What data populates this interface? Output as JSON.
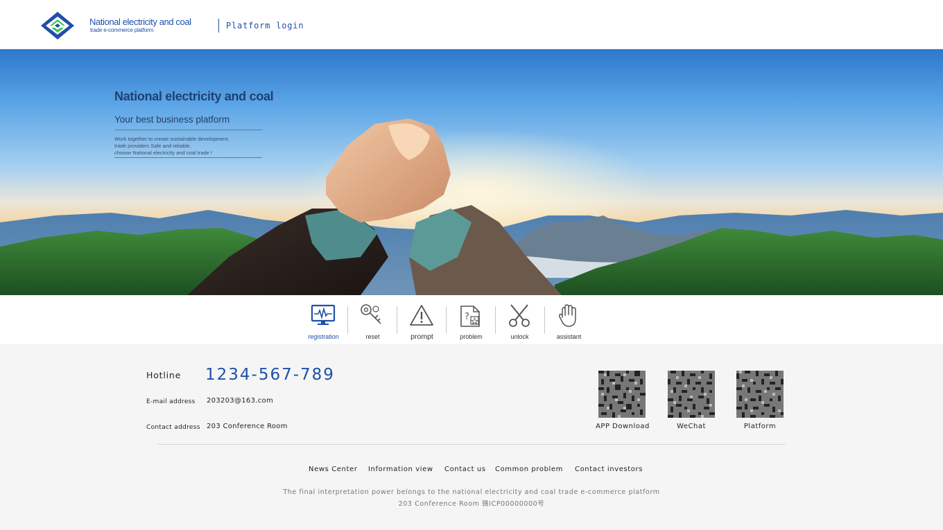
{
  "header": {
    "logo_title": "National electricity and coal",
    "logo_subtitle": "trade e-commerce platform",
    "platform_login": "Platform login"
  },
  "banner": {
    "title": "National electricity and coal",
    "subtitle": "Your best business platform",
    "description": [
      "Work together to create sustainable development,",
      "trade providers Safe and reliable,",
      "choose National electricity and coal trade !"
    ]
  },
  "quickbar": {
    "items": [
      {
        "label": "registration",
        "icon": "monitor-pulse-icon",
        "active": true
      },
      {
        "label": "reset",
        "icon": "key-icon",
        "active": false
      },
      {
        "label": "prompt",
        "icon": "warning-icon",
        "active": false
      },
      {
        "label": "problem",
        "icon": "question-document-icon",
        "active": false
      },
      {
        "label": "unlock",
        "icon": "scissors-icon",
        "active": false
      },
      {
        "label": "assistant",
        "icon": "hand-icon",
        "active": false
      }
    ]
  },
  "contact": {
    "hotline_label": "Hotline",
    "hotline": "1234-567-789",
    "email_label": "E-mail address",
    "email": "203203@163.com",
    "address_label": "Contact address",
    "address": "203 Conference Room"
  },
  "qr_codes": [
    {
      "label": "APP Download"
    },
    {
      "label": "WeChat"
    },
    {
      "label": "Platform"
    }
  ],
  "footer": {
    "links": [
      "News Center",
      "Information view",
      "Contact us",
      "Common problem",
      "Contact investors"
    ],
    "copyright_line1": "The final interpretation power belongs to the national electricity and coal trade e-commerce platform",
    "copyright_line2": "203 Conference Room 赣ICP00000000号"
  },
  "colors": {
    "brand_blue": "#1f4fa8",
    "brand_green": "#3cc24a",
    "footer_bg": "#f5f5f5"
  }
}
